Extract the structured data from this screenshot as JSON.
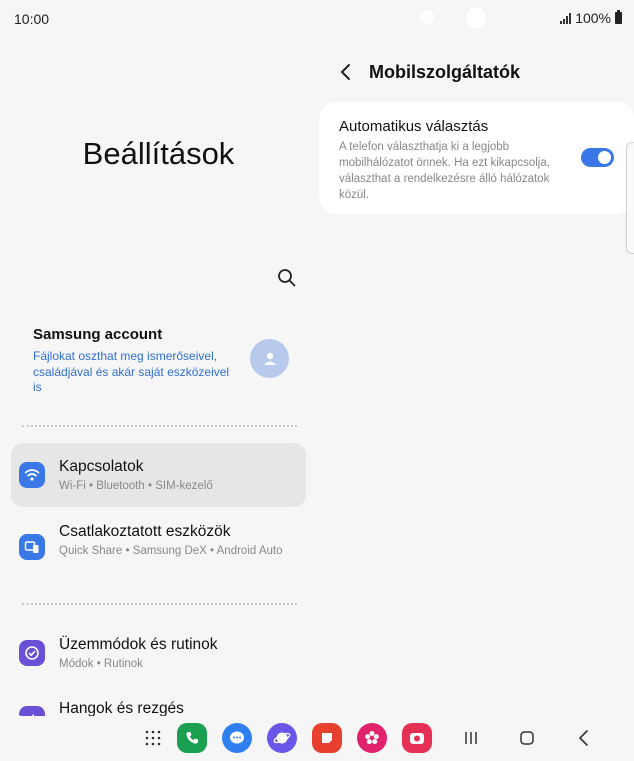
{
  "status_bar": {
    "time": "10:00",
    "battery": "100%"
  },
  "settings": {
    "title": "Beállítások",
    "account": {
      "title": "Samsung account",
      "description": "Fájlokat oszthat meg ismerőseivel, családjával és akár saját eszközeivel is"
    },
    "items": [
      {
        "title": "Kapcsolatok",
        "subtitle": "Wi-Fi  •  Bluetooth  •  SIM-kezelő",
        "icon": "wifi-icon",
        "color": "#3a78e7",
        "selected": true
      },
      {
        "title": "Csatlakoztatott eszközök",
        "subtitle": "Quick Share  •  Samsung DeX  •  Android Auto",
        "icon": "devices-icon",
        "color": "#3a78e7",
        "selected": false
      },
      {
        "title": "Üzemmódok és rutinok",
        "subtitle": "Módok  •  Rutinok",
        "icon": "check-circle-icon",
        "color": "#6b4fd6",
        "selected": false
      },
      {
        "title": "Hangok és rezgés",
        "subtitle": "",
        "icon": "speaker-icon",
        "color": "#6b4fd6",
        "selected": false
      }
    ]
  },
  "detail": {
    "title": "Mobilszolgáltatók",
    "option": {
      "title": "Automatikus választás",
      "description": "A telefon választhatja ki a legjobb mobilhálózatot önnek. Ha ezt kikapcsolja, választhat a rendelkezésre álló hálózatok közül.",
      "enabled": true
    }
  },
  "dock": {
    "apps": [
      {
        "icon": "apps-grid-icon"
      },
      {
        "icon": "phone-icon",
        "color": "#1a9e4f"
      },
      {
        "icon": "messages-icon",
        "color": "#2f7ff0"
      },
      {
        "icon": "internet-icon",
        "color": "#6a57e8"
      },
      {
        "icon": "notes-icon",
        "color": "#e8402f"
      },
      {
        "icon": "gallery-icon",
        "color": "#e0236b"
      },
      {
        "icon": "camera-icon",
        "color": "#e53056"
      }
    ],
    "nav": [
      "recents-icon",
      "home-icon",
      "back-icon"
    ]
  },
  "colors": {
    "accent": "#3a78e7",
    "link": "#2f6fd6",
    "background": "#f6f6f6"
  }
}
